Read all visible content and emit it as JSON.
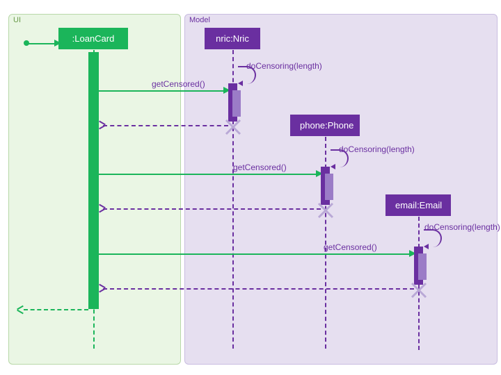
{
  "frames": {
    "ui_label": "UI",
    "model_label": "Model"
  },
  "participants": {
    "loancard": ":LoanCard",
    "nric": "nric:Nric",
    "phone": "phone:Phone",
    "email": "email:Email"
  },
  "messages": {
    "getCensored": "getCensored()",
    "doCensoring": "doCensoring(length)"
  },
  "chart_data": {
    "type": "sequence-diagram",
    "frames": [
      {
        "name": "UI",
        "participants": [
          ":LoanCard"
        ]
      },
      {
        "name": "Model",
        "participants": [
          "nric:Nric",
          "phone:Phone",
          "email:Email"
        ]
      }
    ],
    "participants": [
      ":LoanCard",
      "nric:Nric",
      "phone:Phone",
      "email:Email"
    ],
    "interactions": [
      {
        "from": "external",
        "to": ":LoanCard",
        "type": "found",
        "message": ""
      },
      {
        "from": ":LoanCard",
        "to": "nric:Nric",
        "type": "sync",
        "message": "getCensored()"
      },
      {
        "from": "nric:Nric",
        "to": "nric:Nric",
        "type": "self",
        "message": "doCensoring(length)"
      },
      {
        "from": "nric:Nric",
        "to": ":LoanCard",
        "type": "return",
        "message": ""
      },
      {
        "from": ":LoanCard",
        "to": "phone:Phone",
        "type": "sync",
        "message": "getCensored()"
      },
      {
        "from": "phone:Phone",
        "to": "phone:Phone",
        "type": "self",
        "message": "doCensoring(length)"
      },
      {
        "from": "phone:Phone",
        "to": ":LoanCard",
        "type": "return",
        "message": ""
      },
      {
        "from": ":LoanCard",
        "to": "email:Email",
        "type": "sync",
        "message": "getCensored()"
      },
      {
        "from": "email:Email",
        "to": "email:Email",
        "type": "self",
        "message": "doCensoring(length)"
      },
      {
        "from": "email:Email",
        "to": ":LoanCard",
        "type": "return",
        "message": ""
      },
      {
        "from": ":LoanCard",
        "to": "external",
        "type": "return",
        "message": ""
      }
    ],
    "destroyed": [
      "nric:Nric",
      "phone:Phone",
      "email:Email"
    ]
  }
}
